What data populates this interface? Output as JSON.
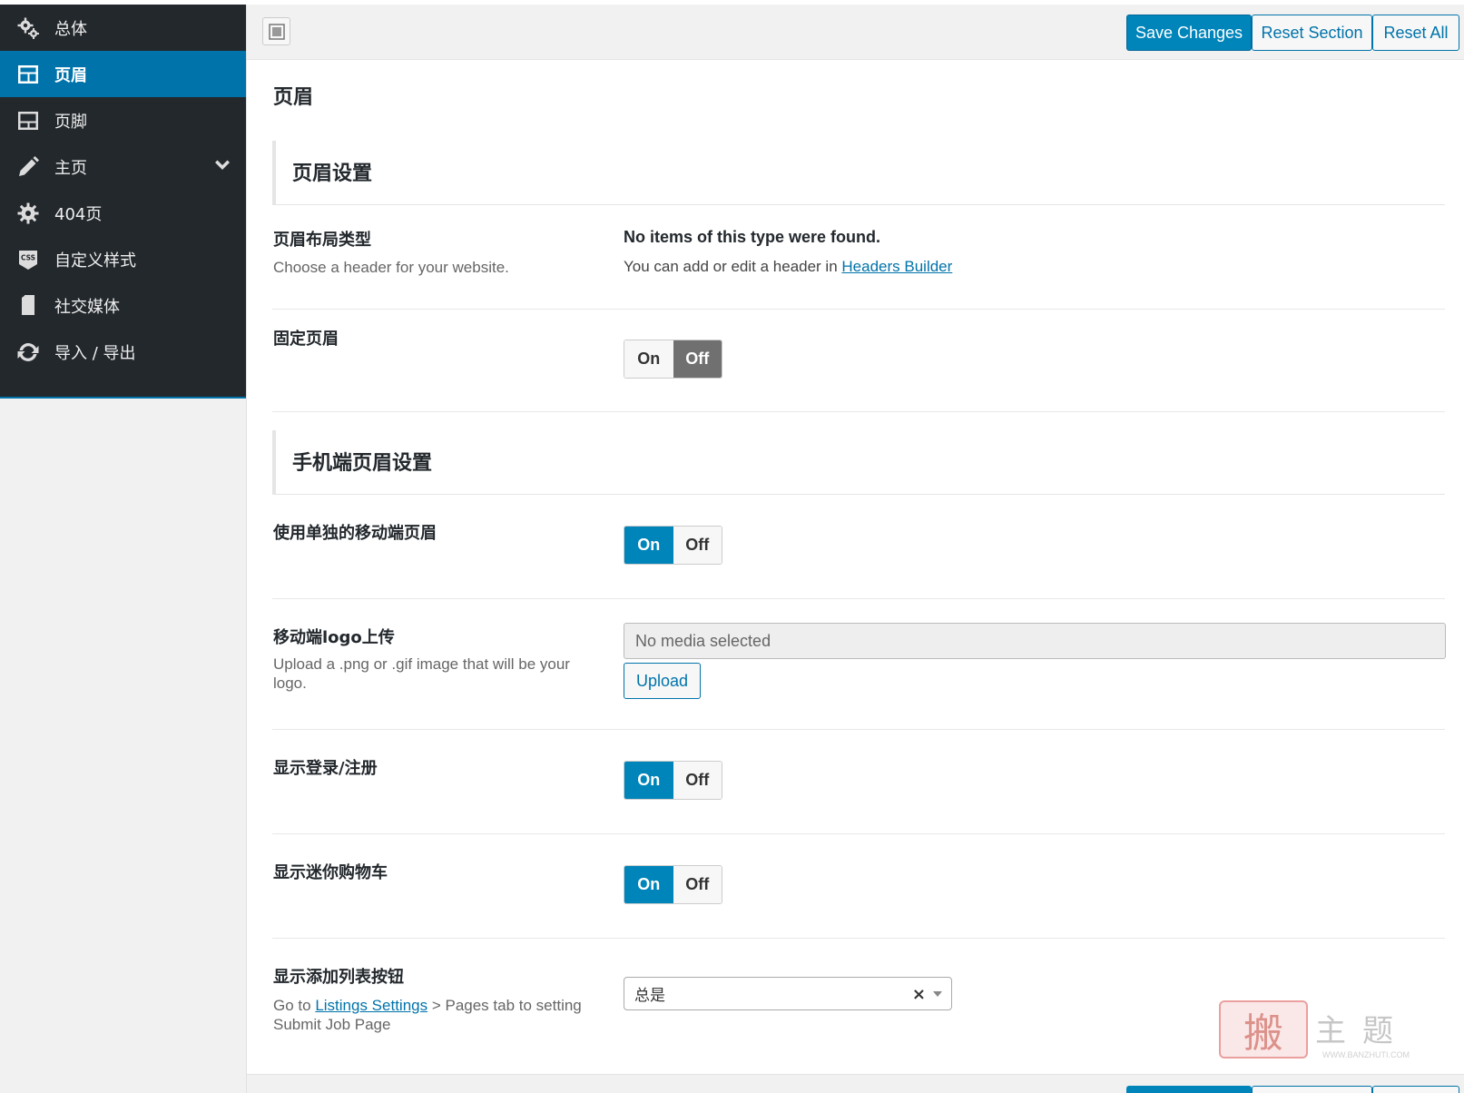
{
  "sidebar": {
    "items": [
      {
        "label": "总体",
        "icon": "gears-icon"
      },
      {
        "label": "页眉",
        "icon": "header-layout-icon",
        "active": true
      },
      {
        "label": "页脚",
        "icon": "footer-layout-icon"
      },
      {
        "label": "主页",
        "icon": "pencil-icon",
        "has_submenu": true
      },
      {
        "label": "404页",
        "icon": "gear-icon"
      },
      {
        "label": "自定义样式",
        "icon": "css-icon"
      },
      {
        "label": "社交媒体",
        "icon": "document-icon"
      },
      {
        "label": "导入 / 导出",
        "icon": "refresh-icon"
      }
    ]
  },
  "toolbar": {
    "save_label": "Save Changes",
    "reset_section_label": "Reset Section",
    "reset_all_label": "Reset All"
  },
  "page_title": "页眉",
  "sections": {
    "header_settings": "页眉设置",
    "mobile_header_settings": "手机端页眉设置"
  },
  "fields": {
    "header_layout": {
      "title": "页眉布局类型",
      "desc": "Choose a header for your website.",
      "notice": "No items of this type were found.",
      "notice_prefix": "You can add or edit a header in ",
      "notice_link": "Headers Builder"
    },
    "sticky_header": {
      "title": "固定页眉",
      "on": "On",
      "off": "Off",
      "value": "off"
    },
    "separate_mobile_header": {
      "title": "使用单独的移动端页眉",
      "on": "On",
      "off": "Off",
      "value": "on"
    },
    "mobile_logo": {
      "title": "移动端logo上传",
      "desc": "Upload a .png or .gif image that will be your logo.",
      "placeholder": "No media selected",
      "upload_label": "Upload"
    },
    "show_login": {
      "title": "显示登录/注册",
      "on": "On",
      "off": "Off",
      "value": "on"
    },
    "show_mini_cart": {
      "title": "显示迷你购物车",
      "on": "On",
      "off": "Off",
      "value": "on"
    },
    "show_add_listing": {
      "title": "显示添加列表按钮",
      "desc_prefix": "Go to ",
      "desc_link": "Listings Settings",
      "desc_suffix": " > Pages tab to setting Submit Job Page",
      "selected": "总是",
      "clear": "×"
    }
  },
  "watermark": {
    "stamp": "搬",
    "text": "主题",
    "url": "WWW.BANZHUTI.COM"
  },
  "colors": {
    "accent": "#0085ba",
    "sidebar_bg": "#23282d",
    "off_selected": "#707070"
  }
}
